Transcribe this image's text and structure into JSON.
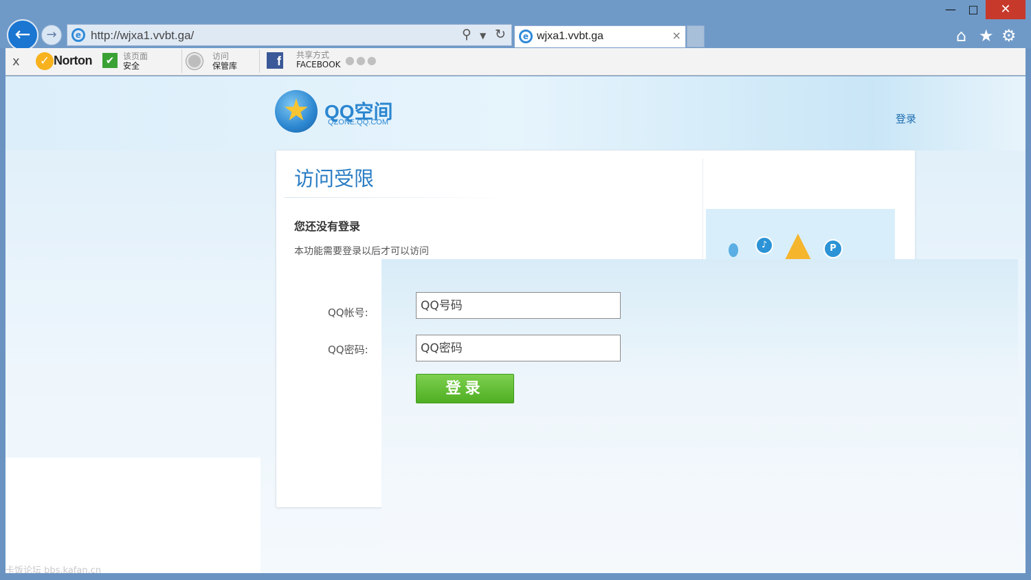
{
  "browser": {
    "url": "http://wjxa1.vvbt.ga/",
    "tab_title": "wjxa1.vvbt.ga",
    "tab_close": "×",
    "back_glyph": "←",
    "forward_glyph": "→",
    "minimize": "—",
    "maximize": "□",
    "close": "✕",
    "icons": [
      "home-icon",
      "star-icon",
      "gear-icon"
    ]
  },
  "toolbar": {
    "close_glyph": "x",
    "norton_name": "Norton",
    "page_safe_line1": "该页面",
    "page_safe_line2": "安全",
    "vault_line1": "访问",
    "vault_line2": "保管库",
    "share_line1": "共享方式",
    "share_line2": "FACEBOOK"
  },
  "header": {
    "logo_title": "QQ空间",
    "logo_subtitle": "QZONE.QQ.COM",
    "login_link": "登录"
  },
  "card": {
    "title": "访问受限",
    "subtitle": "您还没有登录",
    "description": "本功能需要登录以后才可以访问"
  },
  "form": {
    "account_label": "QQ帐号:",
    "password_label": "QQ密码:",
    "account_value": "QQ号码",
    "password_value": "QQ密码",
    "submit_label": "登录"
  },
  "watermark": "卡饭论坛 bbs.kafan.cn",
  "colors": {
    "accent": "#2a7dc4",
    "button": "#5ab52d",
    "chrome": "#6f9ac8",
    "close": "#c7392b"
  }
}
